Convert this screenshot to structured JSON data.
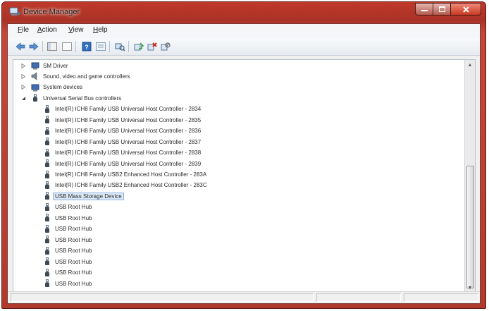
{
  "window": {
    "title": "Device Manager"
  },
  "menu": [
    "File",
    "Action",
    "View",
    "Help"
  ],
  "toolbar": [
    "back-icon",
    "forward-icon",
    "sep",
    "show-hide-console-tree-icon",
    "properties-icon",
    "sep",
    "help-icon",
    "view-icon",
    "sep",
    "scan-hardware-icon",
    "sep",
    "update-driver-icon",
    "uninstall-icon",
    "disable-icon"
  ],
  "tree": [
    {
      "label": "SM Driver",
      "level": 1,
      "expander": "collapsed",
      "icon": "device-warning-icon"
    },
    {
      "label": "Sound, video and game controllers",
      "level": 1,
      "expander": "collapsed",
      "icon": "speaker-icon"
    },
    {
      "label": "System devices",
      "level": 1,
      "expander": "collapsed",
      "icon": "system-devices-icon"
    },
    {
      "label": "Universal Serial Bus controllers",
      "level": 1,
      "expander": "expanded",
      "icon": "usb-icon"
    },
    {
      "label": "Intel(R) ICH8 Family USB Universal Host Controller - 2834",
      "level": 2,
      "icon": "usb-icon"
    },
    {
      "label": "Intel(R) ICH8 Family USB Universal Host Controller - 2835",
      "level": 2,
      "icon": "usb-icon"
    },
    {
      "label": "Intel(R) ICH8 Family USB Universal Host Controller - 2836",
      "level": 2,
      "icon": "usb-icon"
    },
    {
      "label": "Intel(R) ICH8 Family USB Universal Host Controller - 2837",
      "level": 2,
      "icon": "usb-icon"
    },
    {
      "label": "Intel(R) ICH8 Family USB Universal Host Controller - 2838",
      "level": 2,
      "icon": "usb-icon"
    },
    {
      "label": "Intel(R) ICH8 Family USB Universal Host Controller - 2839",
      "level": 2,
      "icon": "usb-icon"
    },
    {
      "label": "Intel(R) ICH8 Family USB2 Enhanced Host Controller - 283A",
      "level": 2,
      "icon": "usb-icon"
    },
    {
      "label": "Intel(R) ICH8 Family USB2 Enhanced Host Controller - 283C",
      "level": 2,
      "icon": "usb-icon"
    },
    {
      "label": "USB Mass Storage Device",
      "level": 2,
      "icon": "usb-icon",
      "selected": true
    },
    {
      "label": "USB Root Hub",
      "level": 2,
      "icon": "usb-icon"
    },
    {
      "label": "USB Root Hub",
      "level": 2,
      "icon": "usb-icon"
    },
    {
      "label": "USB Root Hub",
      "level": 2,
      "icon": "usb-icon"
    },
    {
      "label": "USB Root Hub",
      "level": 2,
      "icon": "usb-icon"
    },
    {
      "label": "USB Root Hub",
      "level": 2,
      "icon": "usb-icon"
    },
    {
      "label": "USB Root Hub",
      "level": 2,
      "icon": "usb-icon"
    },
    {
      "label": "USB Root Hub",
      "level": 2,
      "icon": "usb-icon"
    },
    {
      "label": "USB Root Hub",
      "level": 2,
      "icon": "usb-icon"
    }
  ],
  "colors": {
    "titlebar": "#b03a2e",
    "selection": "#dce9f7"
  }
}
